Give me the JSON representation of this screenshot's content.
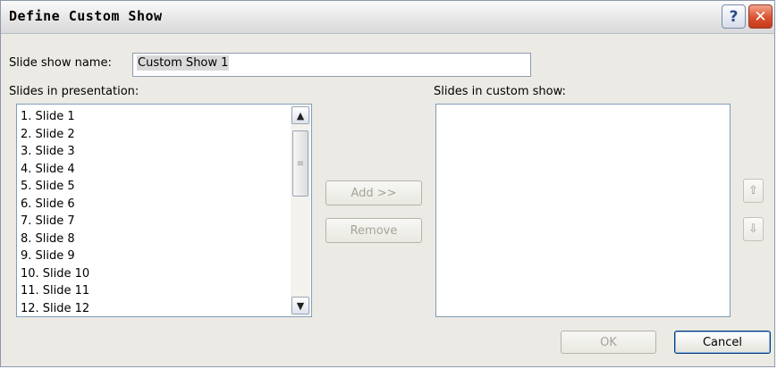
{
  "dialog": {
    "title": "Define Custom Show",
    "help_label": "?",
    "close_label": "✕"
  },
  "name_field": {
    "label": "Slide show name:",
    "value": "Custom Show 1"
  },
  "presentation_list": {
    "label": "Slides in presentation:",
    "items": [
      "1. Slide 1",
      "2. Slide 2",
      "3. Slide 3",
      "4. Slide 4",
      "5. Slide 5",
      "6. Slide 6",
      "7. Slide 7",
      "8. Slide 8",
      "9. Slide 9",
      "10. Slide 10",
      "11. Slide 11",
      "12. Slide 12"
    ]
  },
  "custom_list": {
    "label": "Slides in custom show:",
    "items": []
  },
  "buttons": {
    "add": "Add >>",
    "remove": "Remove",
    "ok": "OK",
    "cancel": "Cancel"
  },
  "icons": {
    "scroll_up": "chevron-up-icon",
    "scroll_down": "chevron-down-icon",
    "move_up": "arrow-up-icon",
    "move_down": "arrow-down-icon",
    "help": "help-icon",
    "close": "close-icon"
  },
  "colors": {
    "dialog_bg": "#eceae4",
    "close_button": "#d9512f",
    "disabled_text": "#a6a398",
    "focus_border": "#003c74"
  }
}
